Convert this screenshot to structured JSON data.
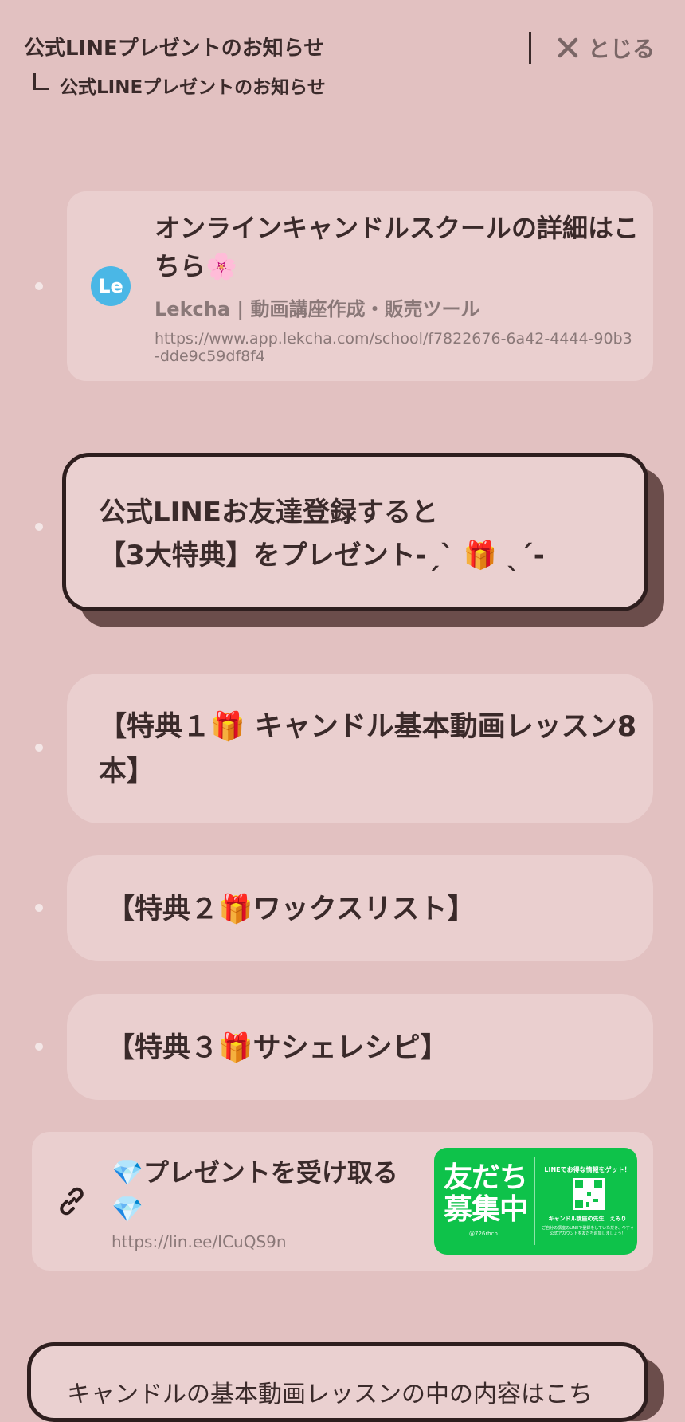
{
  "header": {
    "title": "公式LINEプレゼントのお知らせ",
    "close_label": "とじる",
    "breadcrumb": "公式LINEプレゼントのお知らせ"
  },
  "link_card_1": {
    "title": "オンラインキャンドルスクールの詳細はこちら🌸",
    "site_name": "Lekcha | 動画講座作成・販売ツール",
    "url": "https://www.app.lekcha.com/school/f7822676-6a42-4444-90b3-dde9c59df8f4",
    "avatar_text": "Le",
    "avatar_color": "#4ab7e6"
  },
  "feature_card": {
    "line1": "公式LINEお友達登録すると",
    "line2": "【3大特典】をプレゼント-ˏˋ 🎁 ˎˊ-"
  },
  "bonus_1": "【特典１🎁 キャンドル基本動画レッスン8本】",
  "bonus_2": "【特典２🎁ワックスリスト】",
  "bonus_3": "【特典３🎁サシェレシピ】",
  "link_card_2": {
    "title": "💎プレゼントを受け取る💎",
    "url": "https://lin.ee/ICuQS9n",
    "thumbnail": {
      "big_text_1": "友だち",
      "big_text_2": "募集中",
      "handle": "@726rhcp",
      "top_text": "LINEでお得な情報をゲット！",
      "name": "キャンドル講座の先生　えみり",
      "note": "ご自分の講座のLINEで登録をしていただき、今すぐ公式アカウントを友だち追加しましょう！",
      "bg_color": "#0ec24a"
    }
  },
  "partial_card": {
    "text": "キャンドルの基本動画レッスンの中の内容はこち"
  },
  "colors": {
    "background": "#e2c1c1",
    "card": "#eacfcf",
    "text": "#3a2a2a",
    "muted": "#8a7878",
    "shadow": "#6b4d4b"
  },
  "icons": [
    "close-icon",
    "link-icon"
  ]
}
